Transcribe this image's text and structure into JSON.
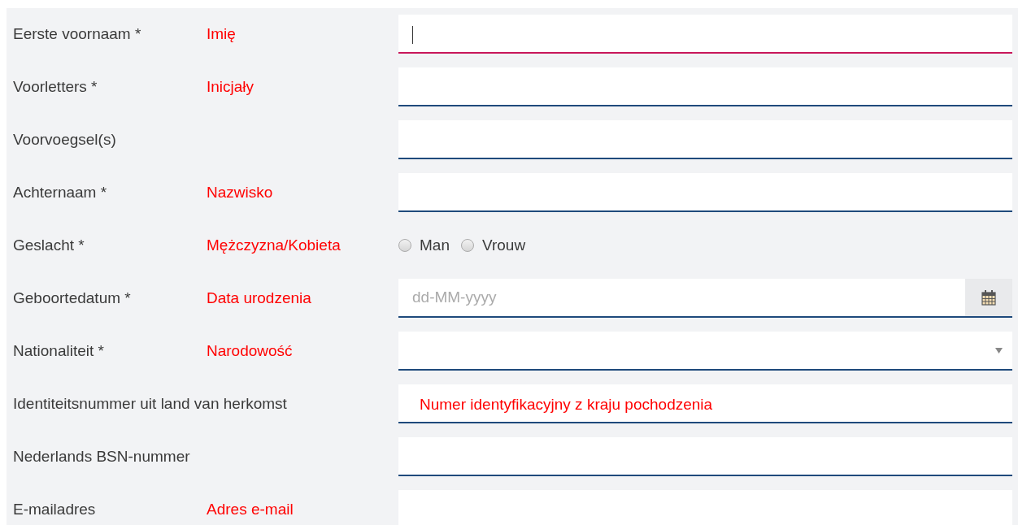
{
  "rows": [
    {
      "label": "Eerste voornaam *",
      "note": "Imię",
      "kind": "text",
      "focused": true
    },
    {
      "label": "Voorletters *",
      "note": "Inicjały",
      "kind": "text",
      "focused": false
    },
    {
      "label": "Voorvoegsel(s)",
      "kind": "text",
      "focused": false
    },
    {
      "label": "Achternaam *",
      "note": "Nazwisko",
      "kind": "text",
      "focused": false
    },
    {
      "label": "Geslacht *",
      "note": "Mężczyzna/Kobieta",
      "kind": "radio",
      "options": [
        {
          "label": "Man",
          "selected": false
        },
        {
          "label": "Vrouw",
          "selected": false
        }
      ]
    },
    {
      "label": "Geboortedatum *",
      "note": "Data urodzenia",
      "kind": "date",
      "placeholder": "dd-MM-yyyy",
      "focused": false
    },
    {
      "label": "Nationaliteit *",
      "note": "Narodowość",
      "kind": "select",
      "focused": false
    },
    {
      "label": "Identiteitsnummer uit land van herkomst",
      "field_note": "Numer identyfikacyjny z kraju pochodzenia",
      "kind": "text",
      "focused": false
    },
    {
      "label": "Nederlands BSN-nummer",
      "kind": "text",
      "focused": false
    },
    {
      "label": "E-mailadres",
      "note": "Adres e-mail",
      "kind": "text",
      "focused": false
    }
  ]
}
